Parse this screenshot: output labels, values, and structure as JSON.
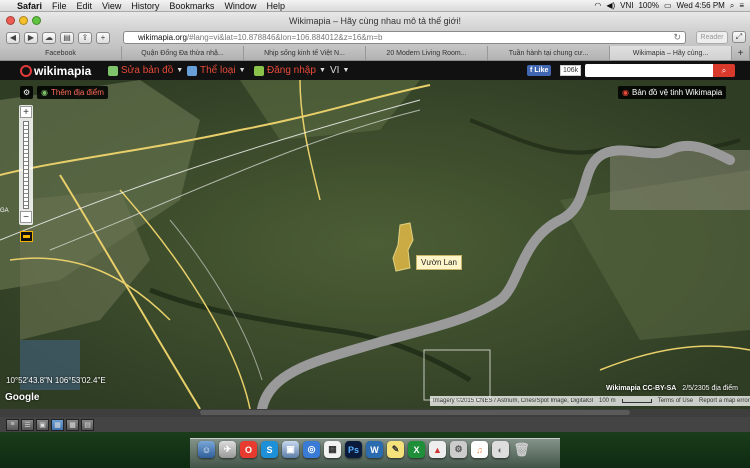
{
  "menubar": {
    "app": "Safari",
    "items": [
      "File",
      "Edit",
      "View",
      "History",
      "Bookmarks",
      "Window",
      "Help"
    ],
    "status": {
      "lang": "VNI",
      "battery": "100%",
      "clock": "Wed 4:56 PM"
    }
  },
  "window": {
    "title": "Wikimapia – Hãy cùng nhau mô tả thế giới!"
  },
  "toolbar": {
    "url_host": "wikimapia.org",
    "url_rest": "/#lang=vi&lat=10.878846&lon=106.884012&z=16&m=b",
    "reader_label": "Reader"
  },
  "tabs": [
    {
      "label": "Facebook"
    },
    {
      "label": "Quận Đống Đa thừa nhậ..."
    },
    {
      "label": "Nhịp sống kinh tế Việt N..."
    },
    {
      "label": "20 Modern Living Room..."
    },
    {
      "label": "Tuần hành tại chung cư..."
    },
    {
      "label": "Wikimapia – Hãy cùng..."
    }
  ],
  "wikimapia": {
    "logo_text": "wikimapia",
    "menu_edit": "Sửa bản đồ",
    "menu_category": "Thể loại",
    "menu_login": "Đăng nhập",
    "menu_lang": "VI",
    "fb_like": "Like",
    "fb_count": "106k"
  },
  "map": {
    "add_place": "Thêm địa điểm",
    "satellite_label": "Bản đồ vệ tinh Wikimapia",
    "place_label": "Vườn Lan",
    "coords": "10°52'43.8\"N 106°53'02.4\"E",
    "google": "Google",
    "license": "Wikimapia CC-BY-SA",
    "license_extra": "2/5/2305 địa điểm",
    "attribution": "Imagery ©2015 CNES / Astrium, Cnes/Spot Image, DigitalGlobe",
    "scale": "100 m",
    "terms": "Terms of Use",
    "report": "Report a map error",
    "ga_label": "GA"
  }
}
